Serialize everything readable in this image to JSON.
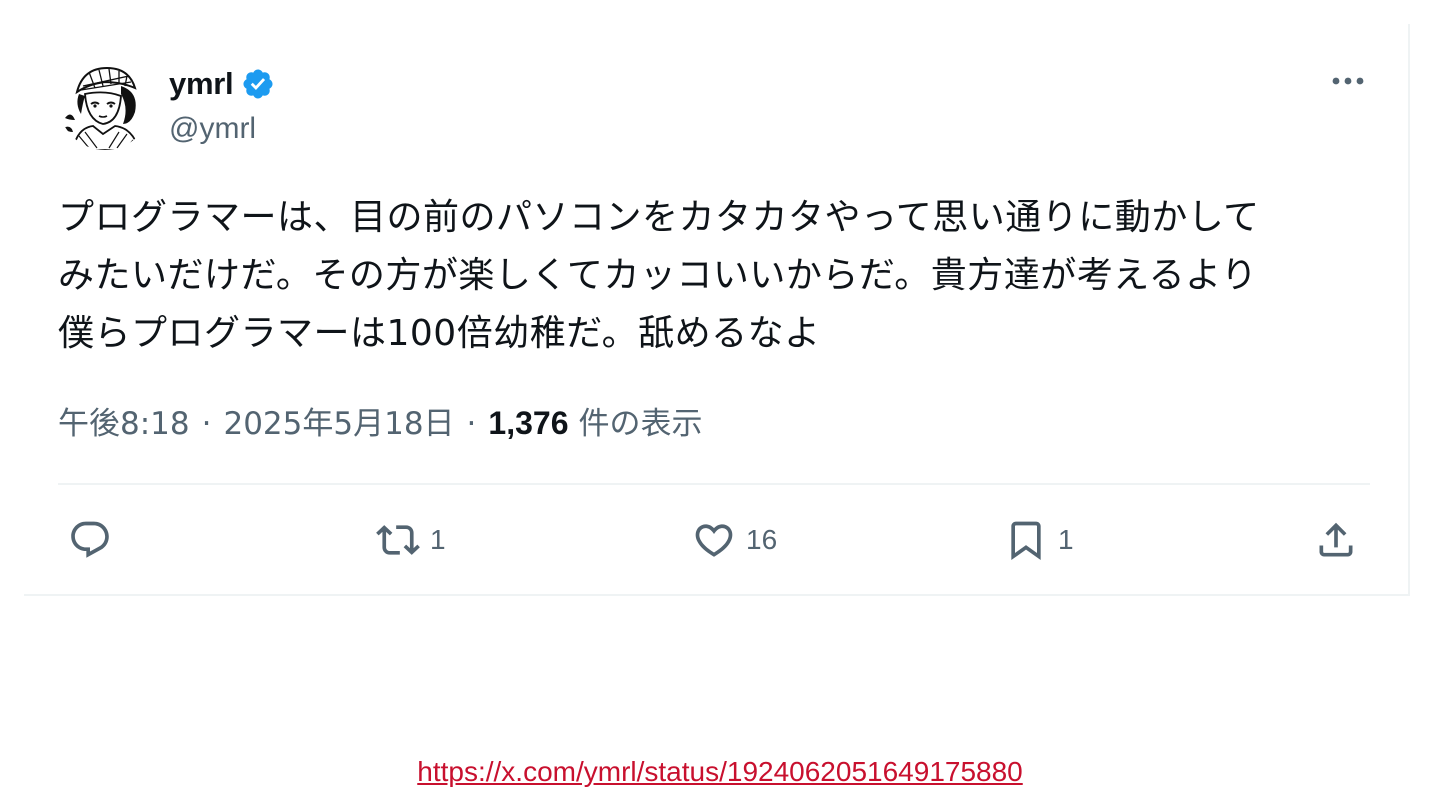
{
  "tweet": {
    "author": {
      "display_name": "ymrl",
      "handle": "@ymrl",
      "verified": true
    },
    "text": "プログラマーは、目の前のパソコンをカタカタやって思い通りに動かして\nみたいだけだ。その方が楽しくてカッコいいからだ。貴方達が考えるより\n僕らプログラマーは100倍幼稚だ。舐めるなよ",
    "time": "午後8:18",
    "date": "2025年5月18日",
    "separator": "·",
    "views_count": "1,376",
    "views_label": "件の表示",
    "actions": {
      "reply_count": "",
      "retweet_count": "1",
      "like_count": "16",
      "bookmark_count": "1"
    }
  },
  "source_url": "https://x.com/ymrl/status/1924062051649175880",
  "colors": {
    "text": "#0f1419",
    "secondary": "#536471",
    "verified": "#1d9bf0",
    "divider": "#eff3f4",
    "link": "#c8102e"
  },
  "icons": {
    "verified": "verified-badge-icon",
    "more": "more-horizontal-icon",
    "reply": "reply-icon",
    "retweet": "retweet-icon",
    "like": "heart-icon",
    "bookmark": "bookmark-icon",
    "share": "share-icon"
  }
}
